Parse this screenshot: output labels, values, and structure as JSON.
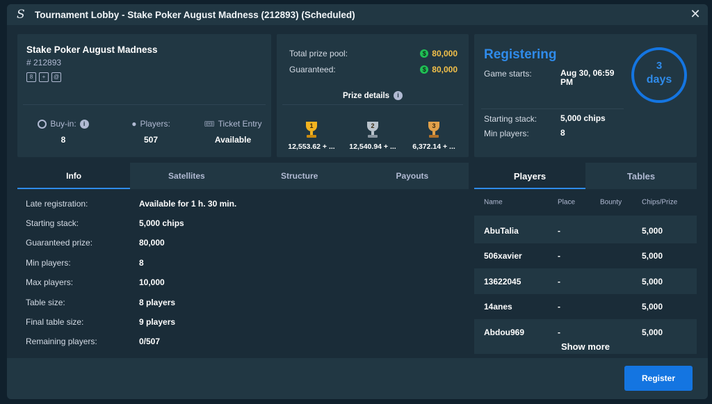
{
  "window": {
    "title": "Tournament Lobby - Stake Poker August Madness (212893) (Scheduled)",
    "logo": "S"
  },
  "tournament": {
    "name": "Stake Poker August Madness",
    "id": "# 212893",
    "badge_icons": [
      "8-max-badge-icon",
      "chip-badge-icon",
      "satellite-badge-icon"
    ],
    "badge_labels": [
      "8",
      "+",
      "@"
    ],
    "buy_in_label": "Buy-in:",
    "buy_in_value": "8",
    "players_label": "Players:",
    "players_value": "507",
    "ticket_label": "Ticket Entry",
    "ticket_value": "Available"
  },
  "prizes": {
    "total_label": "Total prize pool:",
    "total_value": "80,000",
    "guaranteed_label": "Guaranteed:",
    "guaranteed_value": "80,000",
    "details_label": "Prize details",
    "places": [
      {
        "rank": "1",
        "amount": "12,553.62 + ...",
        "color": "#f2b320"
      },
      {
        "rank": "2",
        "amount": "12,540.94 + ...",
        "color": "#b9c3cc"
      },
      {
        "rank": "3",
        "amount": "6,372.14 + ...",
        "color": "#e0a04a"
      }
    ]
  },
  "status": {
    "state": "Registering",
    "starts_label": "Game starts:",
    "starts_value": "Aug 30, 06:59 PM",
    "stack_label": "Starting stack:",
    "stack_value": "5,000 chips",
    "min_label": "Min players:",
    "min_value": "8",
    "countdown_number": "3",
    "countdown_unit": "days"
  },
  "info_tabs": [
    "Info",
    "Satellites",
    "Structure",
    "Payouts"
  ],
  "info_rows": [
    {
      "k": "Late registration:",
      "v": "Available for 1 h. 30 min."
    },
    {
      "k": "Starting stack:",
      "v": "5,000 chips"
    },
    {
      "k": "Guaranteed prize:",
      "v": "80,000"
    },
    {
      "k": "Min players:",
      "v": "8"
    },
    {
      "k": "Max players:",
      "v": "10,000"
    },
    {
      "k": "Table size:",
      "v": "8 players"
    },
    {
      "k": "Final table size:",
      "v": "9 players"
    },
    {
      "k": "Remaining players:",
      "v": "0/507"
    }
  ],
  "players_tabs": [
    "Players",
    "Tables"
  ],
  "players_columns": [
    "Name",
    "Place",
    "Bounty",
    "Chips/Prize"
  ],
  "players": [
    {
      "name": "AbuTalia",
      "place": "-",
      "bounty": "",
      "chips": "5,000"
    },
    {
      "name": "506xavier",
      "place": "-",
      "bounty": "",
      "chips": "5,000"
    },
    {
      "name": "13622045",
      "place": "-",
      "bounty": "",
      "chips": "5,000"
    },
    {
      "name": "14anes",
      "place": "-",
      "bounty": "",
      "chips": "5,000"
    },
    {
      "name": "Abdou969",
      "place": "-",
      "bounty": "",
      "chips": "5,000"
    }
  ],
  "show_more": "Show more",
  "register_label": "Register",
  "colors": {
    "accent": "#1475e1",
    "gold": "#f4c14a",
    "coin": "#1fbf55"
  }
}
